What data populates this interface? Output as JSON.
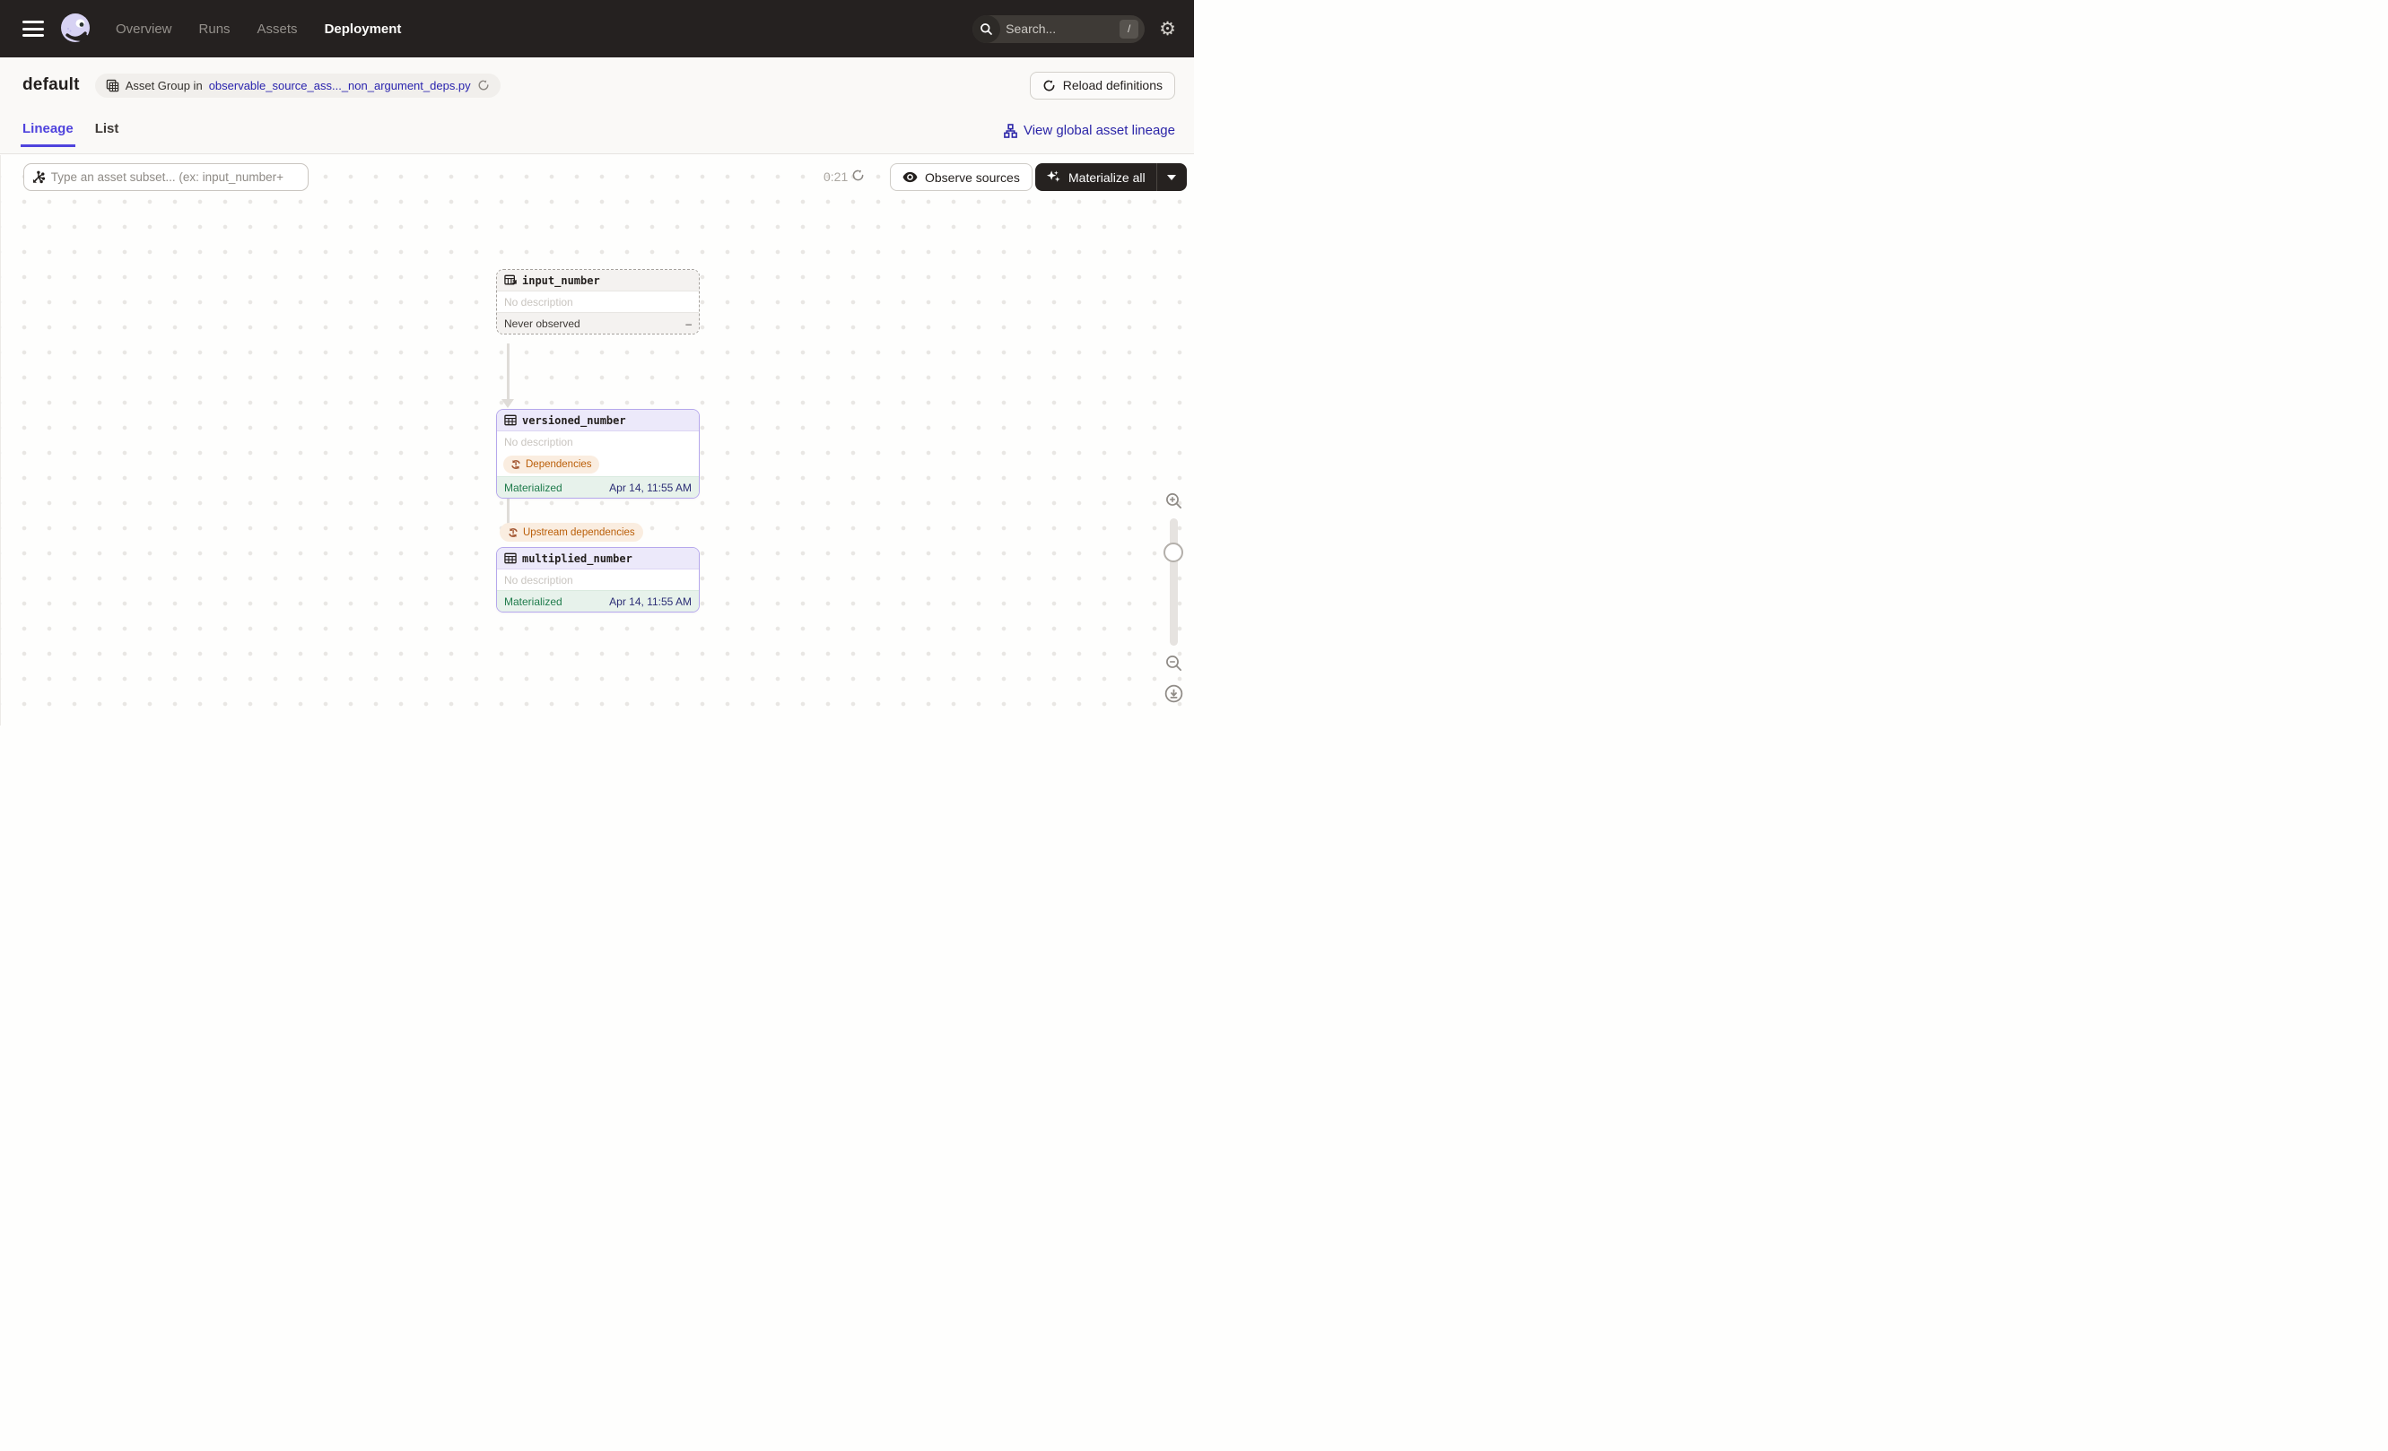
{
  "topnav": {
    "items": [
      {
        "label": "Overview",
        "active": false
      },
      {
        "label": "Runs",
        "active": false
      },
      {
        "label": "Assets",
        "active": false
      },
      {
        "label": "Deployment",
        "active": true
      }
    ],
    "search": {
      "placeholder": "Search...",
      "shortcut": "/"
    }
  },
  "header": {
    "title": "default",
    "asset_group_prefix": "Asset Group in",
    "asset_group_link": "observable_source_ass..._non_argument_deps.py",
    "reload_button": "Reload definitions"
  },
  "tabs": {
    "lineage": "Lineage",
    "list": "List",
    "view_global": "View global asset lineage"
  },
  "toolbar": {
    "subset_placeholder": "Type an asset subset... (ex: input_number+",
    "timer": "0:21",
    "observe_button": "Observe sources",
    "materialize_button": "Materialize all"
  },
  "graph": {
    "edge_label": "Upstream dependencies",
    "nodes": [
      {
        "name": "input_number",
        "description": "No description",
        "status": "Never observed",
        "value": "–"
      },
      {
        "name": "versioned_number",
        "description": "No description",
        "badge": "Dependencies",
        "status": "Materialized",
        "timestamp": "Apr 14, 11:55 AM"
      },
      {
        "name": "multiplied_number",
        "description": "No description",
        "status": "Materialized",
        "timestamp": "Apr 14, 11:55 AM"
      }
    ]
  },
  "colors": {
    "nav_bg": "#252120",
    "accent_indigo": "#4F43DD",
    "link_indigo": "#2B25A8",
    "node_purple_border": "#B6A8EC",
    "node_purple_header": "#ECE9FA",
    "materialized_green": "#1E7B4B",
    "materialized_bg": "#E7F2EB",
    "timestamp_navy": "#2B2D75",
    "warning_orange": "#BA5E08",
    "warning_bg": "#FAEDE0"
  }
}
